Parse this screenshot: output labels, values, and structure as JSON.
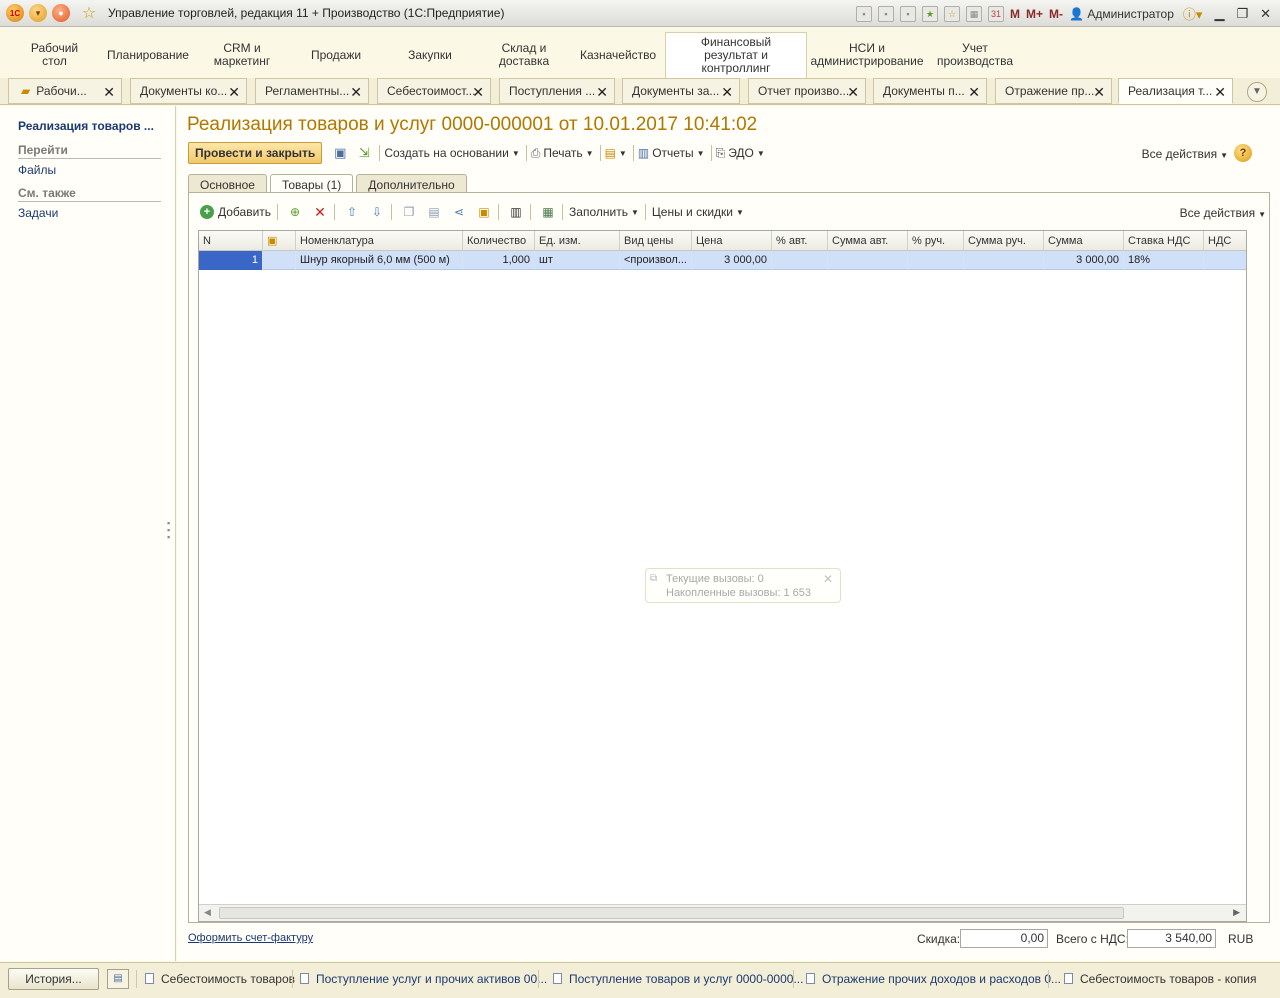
{
  "window": {
    "title": "Управление торговлей, редакция 11 + Производство  (1С:Предприятие)",
    "user": "Администратор",
    "memory_buttons": [
      "M",
      "M+",
      "M-"
    ]
  },
  "sections": [
    {
      "label": "Рабочий стол"
    },
    {
      "label": "Планирование"
    },
    {
      "label": "CRM и маркетинг"
    },
    {
      "label": "Продажи"
    },
    {
      "label": "Закупки"
    },
    {
      "label": "Склад и доставка"
    },
    {
      "label": "Казначейство"
    },
    {
      "label": "Финансовый результат и контроллинг"
    },
    {
      "label": "НСИ и администрирование"
    },
    {
      "label": "Учет производства"
    }
  ],
  "open_tabs": [
    {
      "label": "Рабочи..."
    },
    {
      "label": "Документы ко..."
    },
    {
      "label": "Регламентны..."
    },
    {
      "label": "Себестоимост..."
    },
    {
      "label": "Поступления ..."
    },
    {
      "label": "Документы за..."
    },
    {
      "label": "Отчет произво..."
    },
    {
      "label": "Документы п..."
    },
    {
      "label": "Отражение пр..."
    },
    {
      "label": "Реализация т..."
    }
  ],
  "left_panel": {
    "current": "Реализация товаров ...",
    "goto_title": "Перейти",
    "goto_items": [
      "Файлы"
    ],
    "see_also_title": "См. также",
    "see_also_items": [
      "Задачи"
    ]
  },
  "document": {
    "title": "Реализация товаров и услуг 0000-000001 от 10.01.2017 10:41:02",
    "post_and_close": "Провести и закрыть",
    "create_based_on": "Создать на основании",
    "print": "Печать",
    "reports": "Отчеты",
    "edo": "ЭДО",
    "all_actions": "Все действия",
    "tabs": [
      "Основное",
      "Товары (1)",
      "Дополнительно"
    ],
    "active_tab": "Товары (1)"
  },
  "goods_table": {
    "add_label": "Добавить",
    "fill_label": "Заполнить",
    "prices_label": "Цены и скидки",
    "all_actions": "Все действия",
    "columns": [
      "N",
      "",
      "Номенклатура",
      "Количество",
      "Ед. изм.",
      "Вид цены",
      "Цена",
      "% авт.",
      "Сумма авт.",
      "% руч.",
      "Сумма руч.",
      "Сумма",
      "Ставка НДС",
      "НДС"
    ],
    "rows": [
      [
        "1",
        "",
        "Шнур якорный 6,0 мм (500 м)",
        "1,000",
        "шт",
        "<произвол...",
        "3 000,00",
        "",
        "",
        "",
        "",
        "3 000,00",
        "18%",
        ""
      ]
    ]
  },
  "perf_popup": {
    "current_calls": "Текущие вызовы: 0",
    "accumulated_calls": "Накопленные вызовы: 1 653"
  },
  "footer": {
    "invoice_link": "Оформить счет-фактуру",
    "discount_label": "Скидка:",
    "discount_value": "0,00",
    "total_label": "Всего с НДС:",
    "total_value": "3 540,00",
    "currency": "RUB"
  },
  "taskbar": {
    "history": "История...",
    "items": [
      {
        "label": "Себестоимость товаров"
      },
      {
        "label": "Поступление услуг и прочих активов 00..."
      },
      {
        "label": "Поступление товаров и услуг 0000-0000..."
      },
      {
        "label": "Отражение прочих доходов и расходов 0..."
      },
      {
        "label": "Себестоимость товаров - копия"
      }
    ]
  },
  "colors": {
    "title_accent": "#b07800",
    "link": "#1c3a70",
    "row_selected": "#cfe0f8",
    "cell_current": "#3a66c8"
  }
}
